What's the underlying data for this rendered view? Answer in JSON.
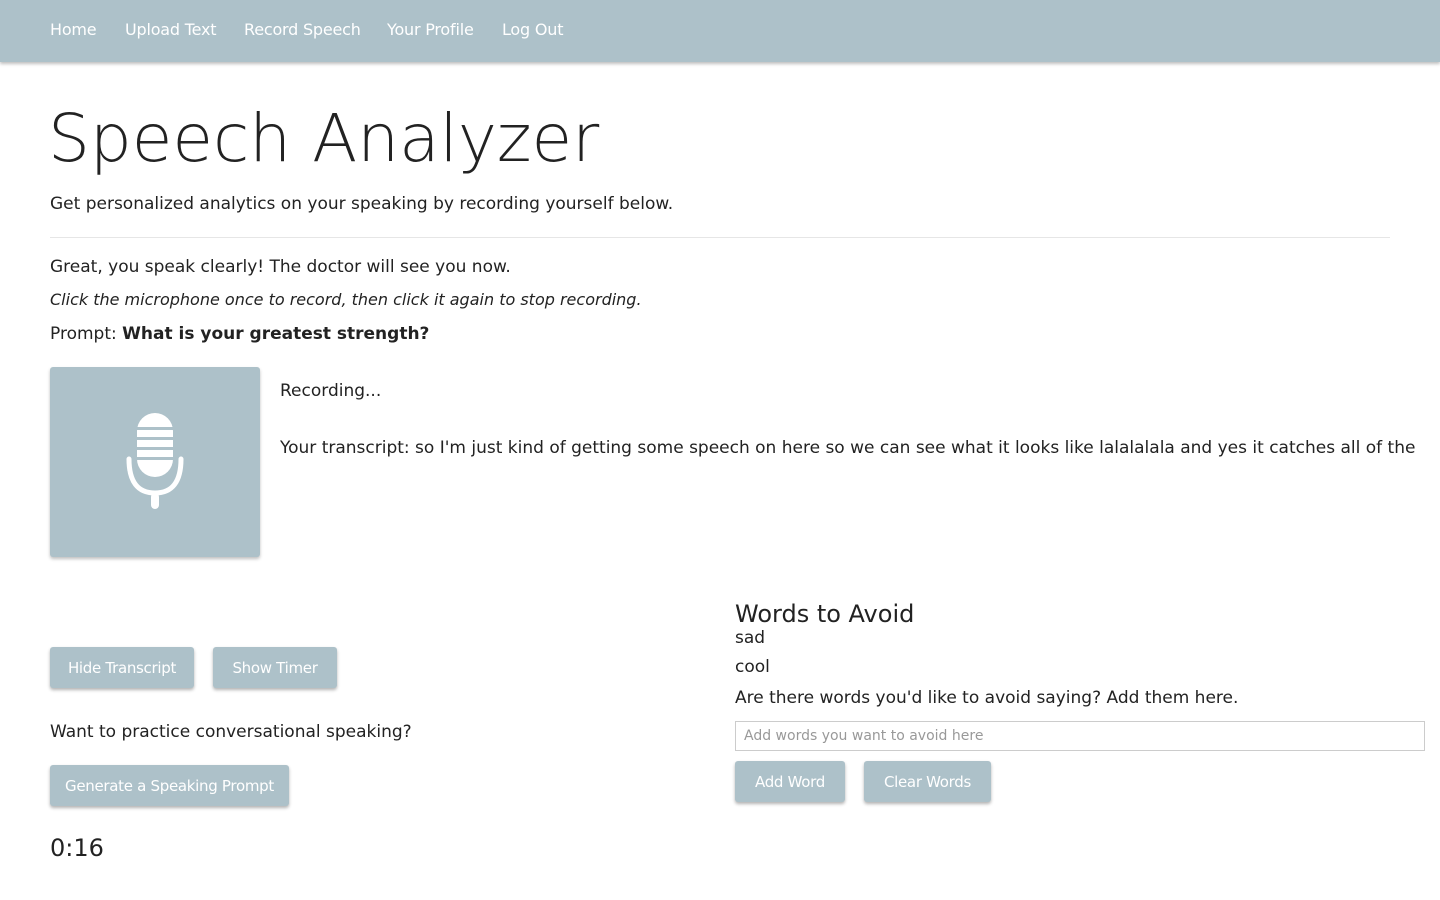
{
  "nav": {
    "home": "Home",
    "upload_text": "Upload Text",
    "record_speech": "Record Speech",
    "your_profile": "Your Profile",
    "log_out": "Log Out"
  },
  "header": {
    "title": "Speech Analyzer",
    "subtitle": "Get personalized analytics on your speaking by recording yourself below."
  },
  "main": {
    "feedback": "Great, you speak clearly! The doctor will see you now.",
    "instruction": "Click the microphone once to record, then click it again to stop recording.",
    "prompt_label": "Prompt: ",
    "prompt_text": "What is your greatest strength?",
    "mic_icon": "microphone-icon",
    "status": "Recording...",
    "transcript": "Your transcript: so I'm just kind of getting some speech on here so we can see what it looks like lalalalala and yes it catches all of the"
  },
  "controls": {
    "hide_transcript": "Hide Transcript",
    "show_timer": "Show Timer",
    "practice_question": "Want to practice conversational speaking?",
    "generate_prompt": "Generate a Speaking Prompt",
    "timer": "0:16"
  },
  "words_to_avoid": {
    "heading": "Words to Avoid",
    "words": [
      "sad",
      "cool"
    ],
    "help_text": "Are there words you'd like to avoid saying? Add them here.",
    "input_placeholder": "Add words you want to avoid here",
    "input_value": "",
    "add_word": "Add Word",
    "clear_words": "Clear Words"
  },
  "colors": {
    "accent": "#adc1c9",
    "text": "#222222"
  }
}
